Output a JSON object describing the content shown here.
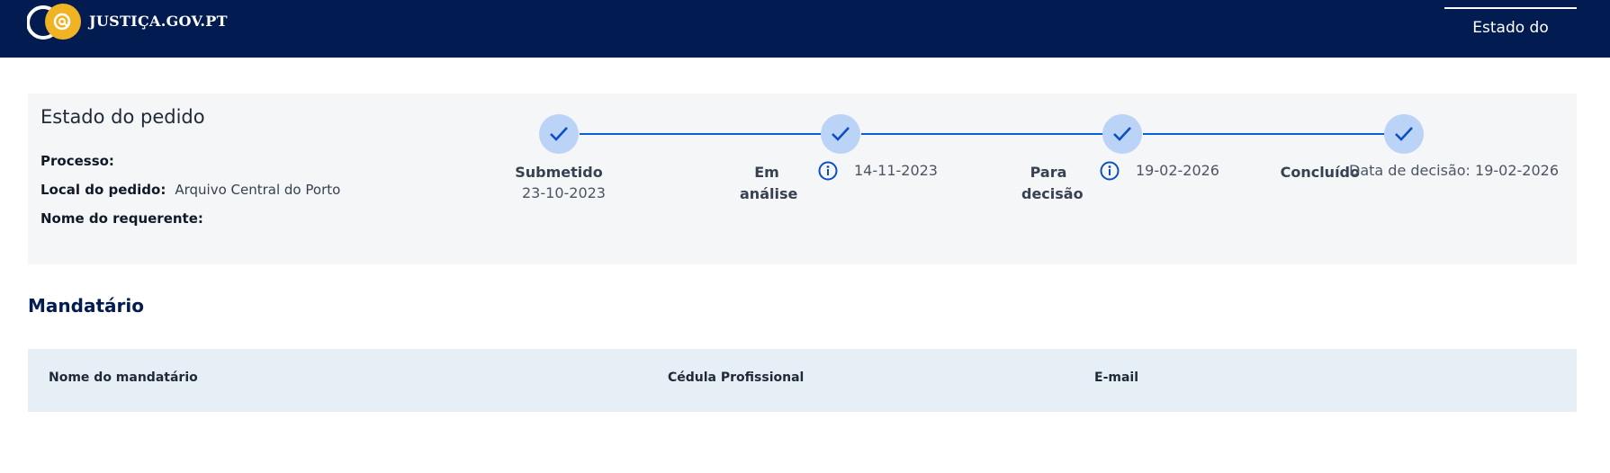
{
  "header": {
    "brand": "JUSTIÇA.GOV.PT",
    "nav_active": "Estado do pedido",
    "colors": {
      "background": "#021c51",
      "logo_accent": "#f0b323"
    }
  },
  "status_panel": {
    "title": "Estado do pedido",
    "fields": [
      {
        "label": "Processo:",
        "value": ""
      },
      {
        "label": "Local do pedido:",
        "value": "Arquivo Central do Porto"
      },
      {
        "label": "Nome do requerente:",
        "value": ""
      }
    ],
    "steps": [
      {
        "label": "Submetido",
        "date": "23-10-2023",
        "icon": "check-icon",
        "has_info": false
      },
      {
        "label": "Em análise",
        "date": "14-11-2023",
        "icon": "check-icon",
        "has_info": true
      },
      {
        "label": "Para decisão",
        "date": "19-02-2026",
        "icon": "check-icon",
        "has_info": true
      },
      {
        "label": "Concluído",
        "date": "Data de decisão: 19-02-2026",
        "icon": "check-icon",
        "has_info": false
      }
    ],
    "colors": {
      "step_fill": "#bcd3f8",
      "line": "#0b5fd6"
    }
  },
  "mandatario": {
    "title": "Mandatário",
    "columns": [
      "Nome do mandatário",
      "Cédula Profissional",
      "E-mail"
    ]
  }
}
